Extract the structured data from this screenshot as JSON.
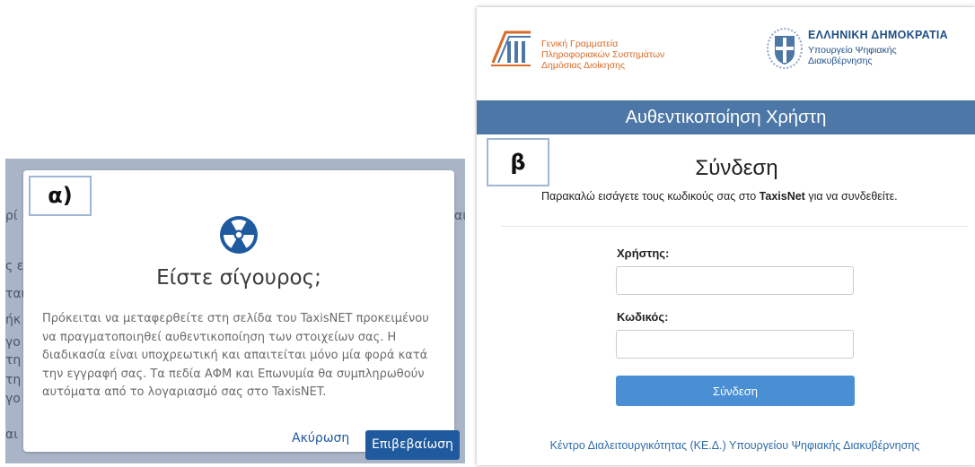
{
  "panel_a": {
    "label": "α)",
    "background_fragments": [
      "ρί",
      "ς ε",
      "ται",
      "ήκ",
      "γο",
      "τη",
      "τη",
      "γο",
      "αι",
      "αι"
    ],
    "dialog": {
      "icon": "radiation-icon",
      "icon_color": "#1f5a9e",
      "title": "Είστε σίγουρος;",
      "body_lines": [
        "Πρόκειται να μεταφερθείτε στη σελίδα του TaxisNET προκειμένου",
        "να πραγματοποιηθεί αυθεντικοποίηση των στοιχείων σας. Η",
        "διαδικασία είναι υποχρεωτική και απαιτείται μόνο μία φορά κατά",
        "την εγγραφή σας. Τα πεδία ΑΦΜ και Επωνυμία θα συμπληρωθούν",
        "αυτόματα από το λογαριασμό σας στο TaxisNET."
      ],
      "cancel_label": "Ακύρωση",
      "confirm_label": "Επιβεβαίωση"
    }
  },
  "panel_b": {
    "label": "β",
    "header": {
      "gsis_lines": [
        "Γενική Γραμματεία",
        "Πληροφοριακών Συστημάτων",
        "Δημόσιας Διοίκησης"
      ],
      "gsis_logo": "gsis-logo-icon",
      "gov_title": "ΕΛΛΗΝΙΚΗ ΔΗΜΟΚΡΑΤΙΑ",
      "gov_lines": [
        "Υπουργείο Ψηφιακής",
        "Διακυβέρνησης"
      ],
      "emblem": "greek-coat-of-arms-icon",
      "accent": "#d96a27",
      "brand": "#1f4f86"
    },
    "auth_bar": "Αυθεντικοποίηση Χρήστη",
    "login": {
      "title": "Σύνδεση",
      "instruction_pre": "Παρακαλώ εισάγετε τους κωδικούς σας στο ",
      "instruction_bold": "TaxisNet",
      "instruction_post": " για να συνδεθείτε.",
      "username_label": "Χρήστης:",
      "username_value": "",
      "password_label": "Κωδικός:",
      "password_value": "",
      "submit_label": "Σύνδεση"
    },
    "footer": "Κέντρο Διαλειτουργικότητας (ΚΕ.Δ.) Υπουργείου Ψηφιακής Διακυβέρνησης"
  }
}
